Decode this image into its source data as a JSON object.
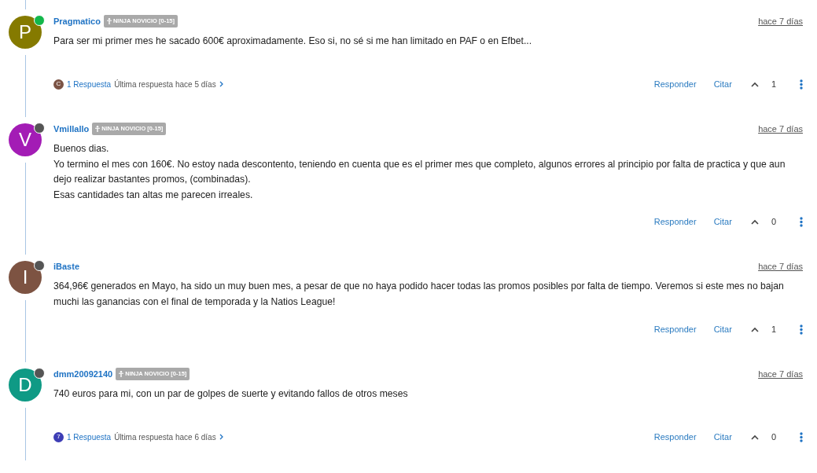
{
  "posts": [
    {
      "avatar": {
        "letter": "P",
        "color": "#857a00"
      },
      "online": true,
      "author": "Pragmatico",
      "badge": "NINJA NOVICIO [0-15]",
      "time": "hace 7 días",
      "paragraphs": [
        "Para ser mi primer mes he sacado 600€ aproximadamente. Eso si, no sé si me han limitado en PAF o en Efbet..."
      ],
      "replies": {
        "avatar": {
          "letter": "C",
          "color": "#7b5344"
        },
        "count": "1 Respuesta",
        "last": "Última respuesta hace 5 días"
      },
      "actions": [
        "Responder",
        "Citar"
      ],
      "votes": "1"
    },
    {
      "avatar": {
        "letter": "V",
        "color": "#a31cb5"
      },
      "online": false,
      "author": "Vmillallo",
      "badge": "NINJA NOVICIO [0-15]",
      "time": "hace 7 días",
      "paragraphs": [
        "Buenos dias.",
        "Yo termino el mes con 160€. No estoy nada descontento, teniendo en cuenta que es el primer mes que completo, algunos errores al principio por falta de practica y que aun dejo realizar bastantes promos, (combinadas).",
        "Esas cantidades tan altas me parecen irreales."
      ],
      "actions": [
        "Responder",
        "Citar"
      ],
      "votes": "0"
    },
    {
      "avatar": {
        "letter": "I",
        "color": "#7d5342"
      },
      "online": false,
      "author": "iBaste",
      "time": "hace 7 días",
      "paragraphs": [
        "364,96€ generados en Mayo, ha sido un muy buen mes, a pesar de que no haya podido hacer todas las promos posibles por falta de tiempo. Veremos si este mes no bajan muchi las ganancias con el final de temporada y la Natios League!"
      ],
      "actions": [
        "Responder",
        "Citar"
      ],
      "votes": "1"
    },
    {
      "avatar": {
        "letter": "D",
        "color": "#0f9a85"
      },
      "online": false,
      "author": "dmm20092140",
      "badge": "NINJA NOVICIO [0-15]",
      "time": "hace 7 días",
      "paragraphs": [
        "740 euros para mi, con un par de golpes de suerte y evitando fallos de otros meses"
      ],
      "replies": {
        "avatar": {
          "letter": "7",
          "color": "#3d3db5"
        },
        "count": "1 Respuesta",
        "last": "Última respuesta hace 6 días"
      },
      "actions": [
        "Responder",
        "Citar"
      ],
      "votes": "0"
    }
  ]
}
